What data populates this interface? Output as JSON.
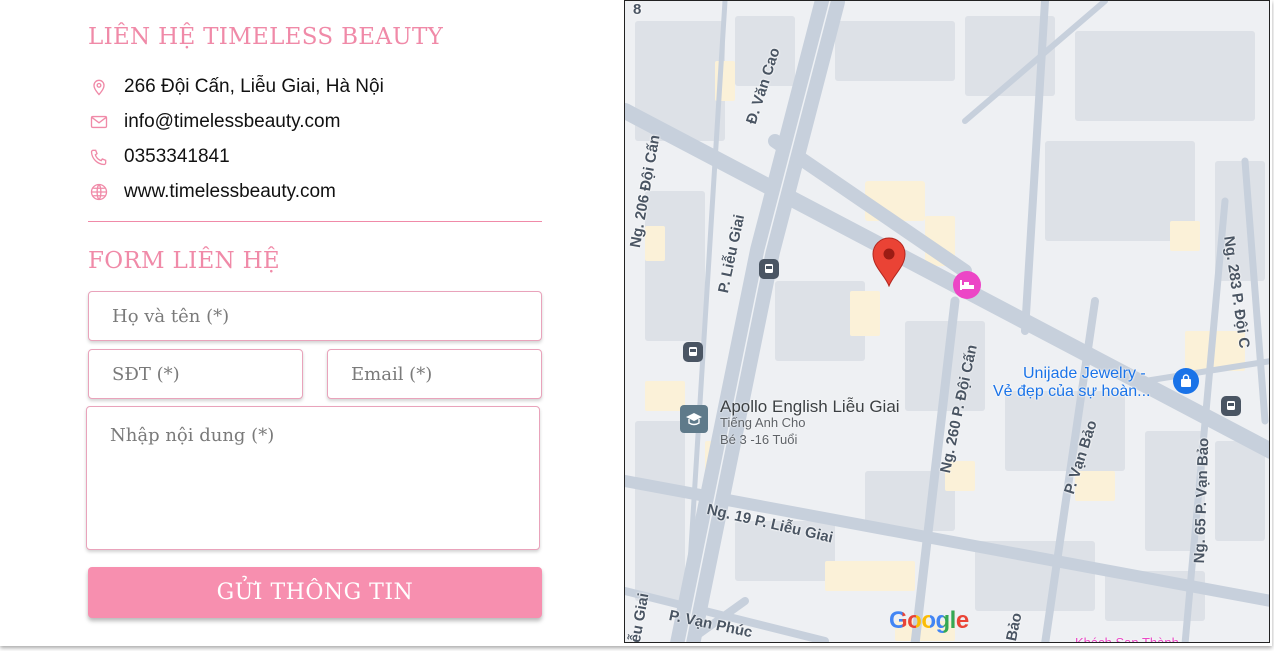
{
  "contact": {
    "title": "LIÊN HỆ TIMELESS BEAUTY",
    "address": "266 Đội Cấn, Liễu Giai, Hà Nội",
    "email": "info@timelessbeauty.com",
    "phone": "0353341841",
    "website": "www.timelessbeauty.com",
    "icons": {
      "address": "location-pin-icon",
      "email": "envelope-icon",
      "phone": "phone-icon",
      "website": "globe-icon"
    }
  },
  "form": {
    "title": "FORM LIÊN HỆ",
    "name_placeholder": "Họ và tên (*)",
    "phone_placeholder": "SĐT (*)",
    "email_placeholder": "Email (*)",
    "message_placeholder": "Nhập nội dung (*)",
    "submit_label": "GỬI THÔNG TIN"
  },
  "map": {
    "streets": {
      "van_cao": "Đ. Văn Cao",
      "doi_can_left": "Ng. 206 Đội Cấn",
      "lieu_giai": "P. Liễu Giai",
      "ng_260": "Ng. 260 P. Đội Cấn",
      "van_bao": "P. Vạn Bảo",
      "ng_19": "Ng. 19 P. Liễu Giai",
      "ng_65": "Ng. 65 P. Vạn Bảo",
      "ng_283": "Ng. 283 P. Đội C",
      "van_phuc": "P. Vạn Phúc",
      "lieu_giai_bottom": "ễu Giai",
      "bao_bottom": "Bảo",
      "top_number": "8"
    },
    "pois": {
      "unijade_name": "Unijade Jewelry -",
      "unijade_sub": "Vẻ đẹp của sự hoàn...",
      "apollo_name": "Apollo English Liễu Giai",
      "apollo_sub1": "Tiếng Anh Cho",
      "apollo_sub2": "Bé 3 -16 Tuổi",
      "bottom_cut": "Khách Sạn Thành"
    },
    "google": "Google",
    "colors": {
      "pin": "#ea4335",
      "hotel": "#ec46c6",
      "shop": "#1a73e8",
      "school": "#5f7a8a"
    }
  }
}
